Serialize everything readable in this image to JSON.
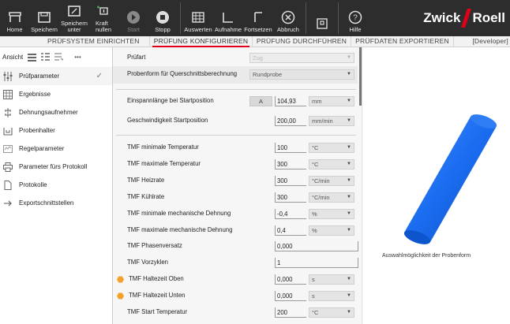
{
  "ribbon": {
    "buttons": [
      {
        "label": "Home",
        "icon": "home-icon"
      },
      {
        "label": "Speichern",
        "icon": "save-icon"
      },
      {
        "label": "Speichern\nunter",
        "icon": "save-as-icon"
      },
      {
        "label": "Kraft\nnullen",
        "icon": "force-zero-icon"
      },
      {
        "label": "Start",
        "icon": "start-icon"
      },
      {
        "label": "Stopp",
        "icon": "stop-icon"
      },
      {
        "label": "Auswerten",
        "icon": "evaluate-icon"
      },
      {
        "label": "Aufnahme",
        "icon": "record-icon"
      },
      {
        "label": "Fortsetzen",
        "icon": "continue-icon"
      },
      {
        "label": "Abbruch",
        "icon": "abort-icon"
      },
      {
        "label": "",
        "icon": "clipboard-icon"
      },
      {
        "label": "Hilfe",
        "icon": "help-icon"
      }
    ],
    "logo_left": "Zwick",
    "logo_right": "Roell"
  },
  "tabs": [
    {
      "label": "PRÜFSYSTEM EINRICHTEN"
    },
    {
      "label": "PRÜFUNG KONFIGURIEREN"
    },
    {
      "label": "PRÜFUNG DURCHFÜHREN"
    },
    {
      "label": "PRÜFDATEN EXPORTIEREN"
    },
    {
      "label": "[Developer]"
    }
  ],
  "sidebar": {
    "view_label": "Ansicht",
    "more": "•••",
    "items": [
      {
        "label": "Prüfparameter",
        "icon": "parameter-icon"
      },
      {
        "label": "Ergebnisse",
        "icon": "results-icon"
      },
      {
        "label": "Dehnungsaufnehmer",
        "icon": "extensometer-icon"
      },
      {
        "label": "Probenhalter",
        "icon": "specimen-holder-icon"
      },
      {
        "label": "Regelparameter",
        "icon": "control-parameter-icon"
      },
      {
        "label": "Parameter fürs Protokoll",
        "icon": "printer-icon"
      },
      {
        "label": "Protokolle",
        "icon": "document-icon"
      },
      {
        "label": "Exportschnittstellen",
        "icon": "arrow-right-icon"
      }
    ],
    "check": "✓"
  },
  "form": {
    "pruefart_label": "Prüfart",
    "pruefart_value": "Zug",
    "probenform_label": "Probenform für Querschnittsberechnung",
    "probenform_value": "Rundprobe",
    "einspann_label": "Einspannlänge bei Startposition",
    "einspann_btn": "A",
    "einspann_value": "104,93",
    "einspann_unit": "mm",
    "gesch_label": "Geschwindigkeit Startposition",
    "gesch_value": "200,00",
    "gesch_unit": "mm/min",
    "rows": [
      {
        "label": "TMF minimale Temperatur",
        "value": "100",
        "unit": "°C",
        "warn": false
      },
      {
        "label": "TMF maximale Temperatur",
        "value": "300",
        "unit": "°C",
        "warn": false
      },
      {
        "label": "TMF Heizrate",
        "value": "300",
        "unit": "°C/min",
        "warn": false
      },
      {
        "label": "TMF Kühlrate",
        "value": "300",
        "unit": "°C/min",
        "warn": false
      },
      {
        "label": "TMF minimale mechanische Dehnung",
        "value": "-0,4",
        "unit": "%",
        "warn": false
      },
      {
        "label": "TMF maximale mechanische Dehnung",
        "value": "0,4",
        "unit": "%",
        "warn": false
      },
      {
        "label": "TMF Phasenversatz",
        "value": "0,000",
        "unit": "",
        "warn": false
      },
      {
        "label": "TMF Vorzyklen",
        "value": "1",
        "unit": "",
        "warn": false
      },
      {
        "label": "TMF Haltezeit Oben",
        "value": "0,000",
        "unit": "s",
        "warn": true
      },
      {
        "label": "TMF Haltezeit Unten",
        "value": "0,000",
        "unit": "s",
        "warn": true
      },
      {
        "label": "TMF Start Temperatur",
        "value": "200",
        "unit": "°C",
        "warn": false
      }
    ]
  },
  "preview": {
    "caption": "Auswahlmöglichkeit der Probenform",
    "cylinder_color": "#1a6cf0"
  }
}
